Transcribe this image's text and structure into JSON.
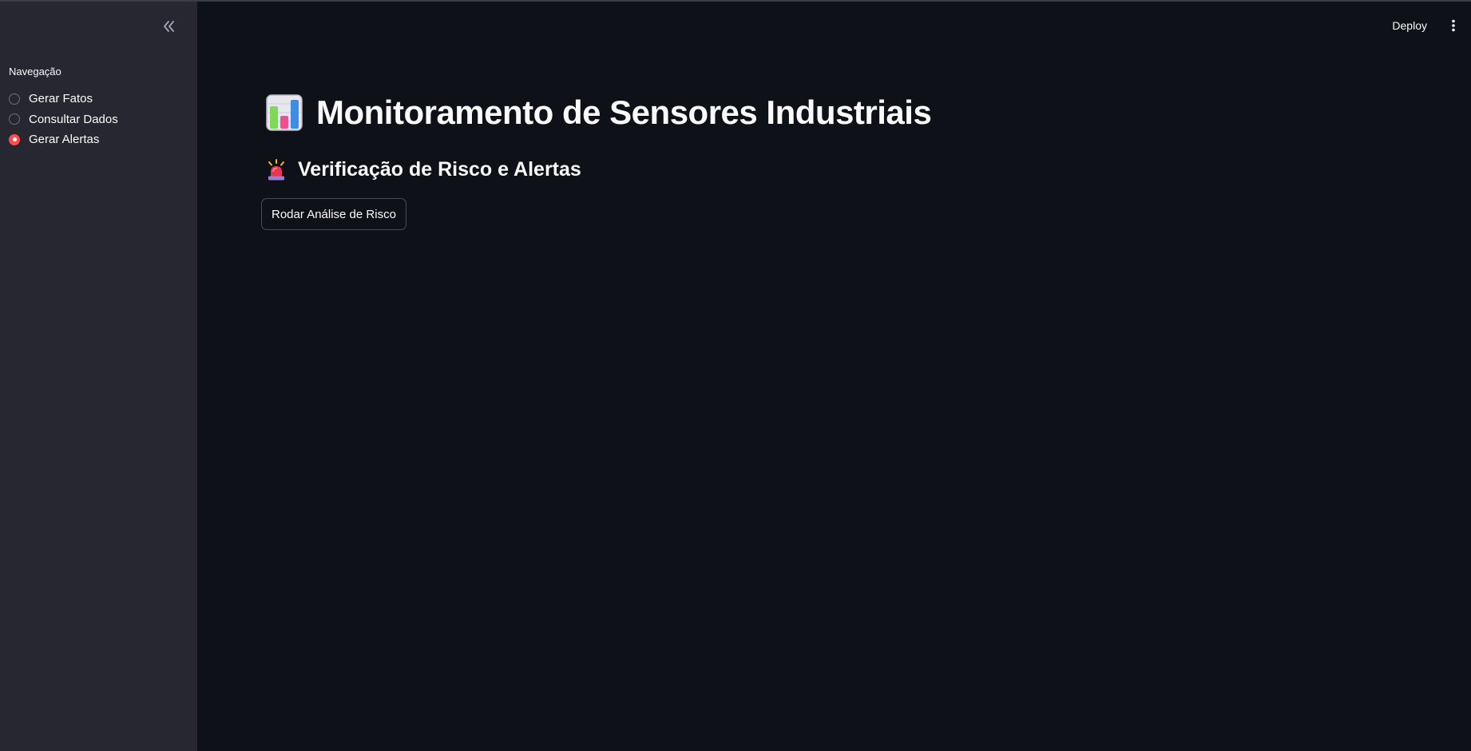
{
  "sidebar": {
    "collapse_icon": "chevron-double-left-icon",
    "nav_label": "Navegação",
    "items": [
      {
        "label": "Gerar Fatos",
        "selected": false
      },
      {
        "label": "Consultar Dados",
        "selected": false
      },
      {
        "label": "Gerar Alertas",
        "selected": true
      }
    ]
  },
  "header": {
    "deploy_label": "Deploy",
    "menu_icon": "vertical-dots-icon"
  },
  "main": {
    "title": "Monitoramento de Sensores Industriais",
    "title_icon": "bar-chart-icon",
    "subtitle": "Verificação de Risco e Alertas",
    "subtitle_icon": "rotating-light-icon",
    "button_label": "Rodar Análise de Risco"
  },
  "colors": {
    "background": "#0e1117",
    "sidebar": "#262730",
    "accent": "#ff4b4b",
    "text": "#fafafa"
  }
}
